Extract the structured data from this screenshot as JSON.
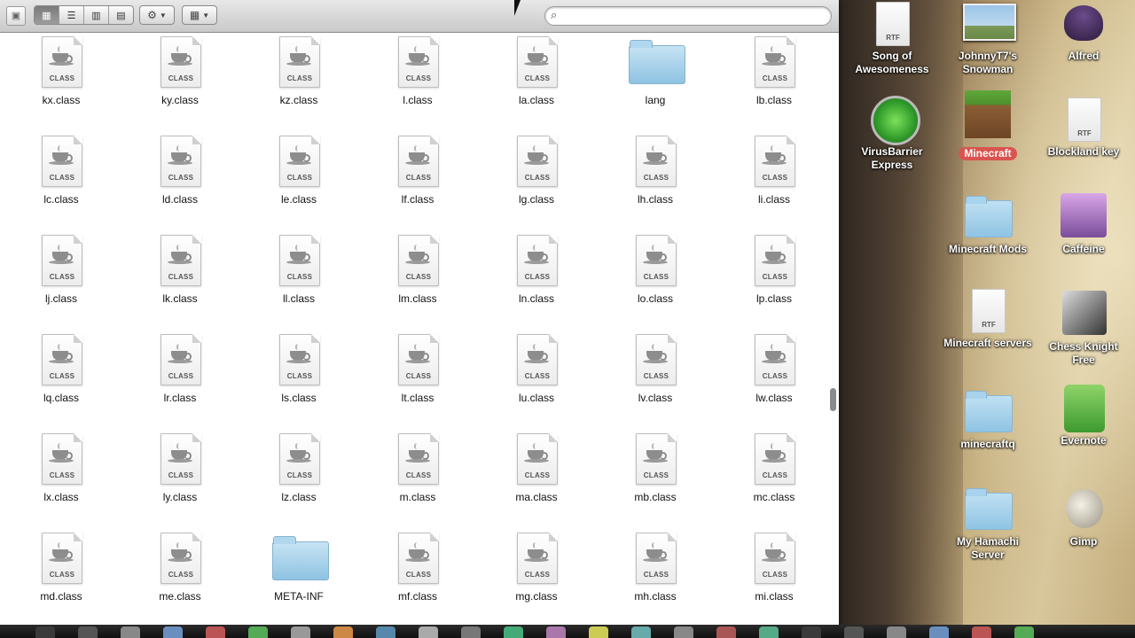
{
  "toolbar": {
    "view_buttons": [
      "icon-view",
      "list-view",
      "column-view",
      "coverflow-view"
    ],
    "action_menu": "gear-icon",
    "arrange_menu": "grid-icon",
    "search_placeholder": ""
  },
  "files": [
    {
      "name": "kx.class",
      "kind": "class"
    },
    {
      "name": "ky.class",
      "kind": "class"
    },
    {
      "name": "kz.class",
      "kind": "class"
    },
    {
      "name": "l.class",
      "kind": "class"
    },
    {
      "name": "la.class",
      "kind": "class"
    },
    {
      "name": "lang",
      "kind": "folder"
    },
    {
      "name": "lb.class",
      "kind": "class"
    },
    {
      "name": "lc.class",
      "kind": "class"
    },
    {
      "name": "ld.class",
      "kind": "class"
    },
    {
      "name": "le.class",
      "kind": "class"
    },
    {
      "name": "lf.class",
      "kind": "class"
    },
    {
      "name": "lg.class",
      "kind": "class"
    },
    {
      "name": "lh.class",
      "kind": "class"
    },
    {
      "name": "li.class",
      "kind": "class"
    },
    {
      "name": "lj.class",
      "kind": "class"
    },
    {
      "name": "lk.class",
      "kind": "class"
    },
    {
      "name": "ll.class",
      "kind": "class"
    },
    {
      "name": "lm.class",
      "kind": "class"
    },
    {
      "name": "ln.class",
      "kind": "class"
    },
    {
      "name": "lo.class",
      "kind": "class"
    },
    {
      "name": "lp.class",
      "kind": "class"
    },
    {
      "name": "lq.class",
      "kind": "class"
    },
    {
      "name": "lr.class",
      "kind": "class"
    },
    {
      "name": "ls.class",
      "kind": "class"
    },
    {
      "name": "lt.class",
      "kind": "class"
    },
    {
      "name": "lu.class",
      "kind": "class"
    },
    {
      "name": "lv.class",
      "kind": "class"
    },
    {
      "name": "lw.class",
      "kind": "class"
    },
    {
      "name": "lx.class",
      "kind": "class"
    },
    {
      "name": "ly.class",
      "kind": "class"
    },
    {
      "name": "lz.class",
      "kind": "class"
    },
    {
      "name": "m.class",
      "kind": "class"
    },
    {
      "name": "ma.class",
      "kind": "class"
    },
    {
      "name": "mb.class",
      "kind": "class"
    },
    {
      "name": "mc.class",
      "kind": "class"
    },
    {
      "name": "md.class",
      "kind": "class"
    },
    {
      "name": "me.class",
      "kind": "class"
    },
    {
      "name": "META-INF",
      "kind": "folder"
    },
    {
      "name": "mf.class",
      "kind": "class"
    },
    {
      "name": "mg.class",
      "kind": "class"
    },
    {
      "name": "mh.class",
      "kind": "class"
    },
    {
      "name": "mi.class",
      "kind": "class"
    }
  ],
  "class_tag": "CLASS",
  "desktop": [
    {
      "label": "Song of Awesomeness",
      "icon": "rtf-document-icon",
      "tag": "RTF"
    },
    {
      "label": "JohnnyT7's Snowman",
      "icon": "image-thumbnail-icon"
    },
    {
      "label": "Alfred",
      "icon": "alfred-hat-icon"
    },
    {
      "label": "VirusBarrier Express",
      "icon": "virusbarrier-icon"
    },
    {
      "label": "Minecraft",
      "icon": "minecraft-block-icon"
    },
    {
      "label": "Blockland key",
      "icon": "rtf-document-icon",
      "tag": "RTF"
    },
    {
      "label": "Minecraft Mods",
      "icon": "folder-icon"
    },
    {
      "label": "Caffeine",
      "icon": "caffeine-cup-icon"
    },
    {
      "label": "Minecraft servers",
      "icon": "rtf-document-icon",
      "tag": "RTF"
    },
    {
      "label": "Chess Knight Free",
      "icon": "chess-knight-icon"
    },
    {
      "label": "minecraftq",
      "icon": "folder-icon"
    },
    {
      "label": "Evernote",
      "icon": "evernote-elephant-icon"
    },
    {
      "label": "My Hamachi Server",
      "icon": "folder-icon"
    },
    {
      "label": "Gimp",
      "icon": "gimp-icon"
    }
  ]
}
